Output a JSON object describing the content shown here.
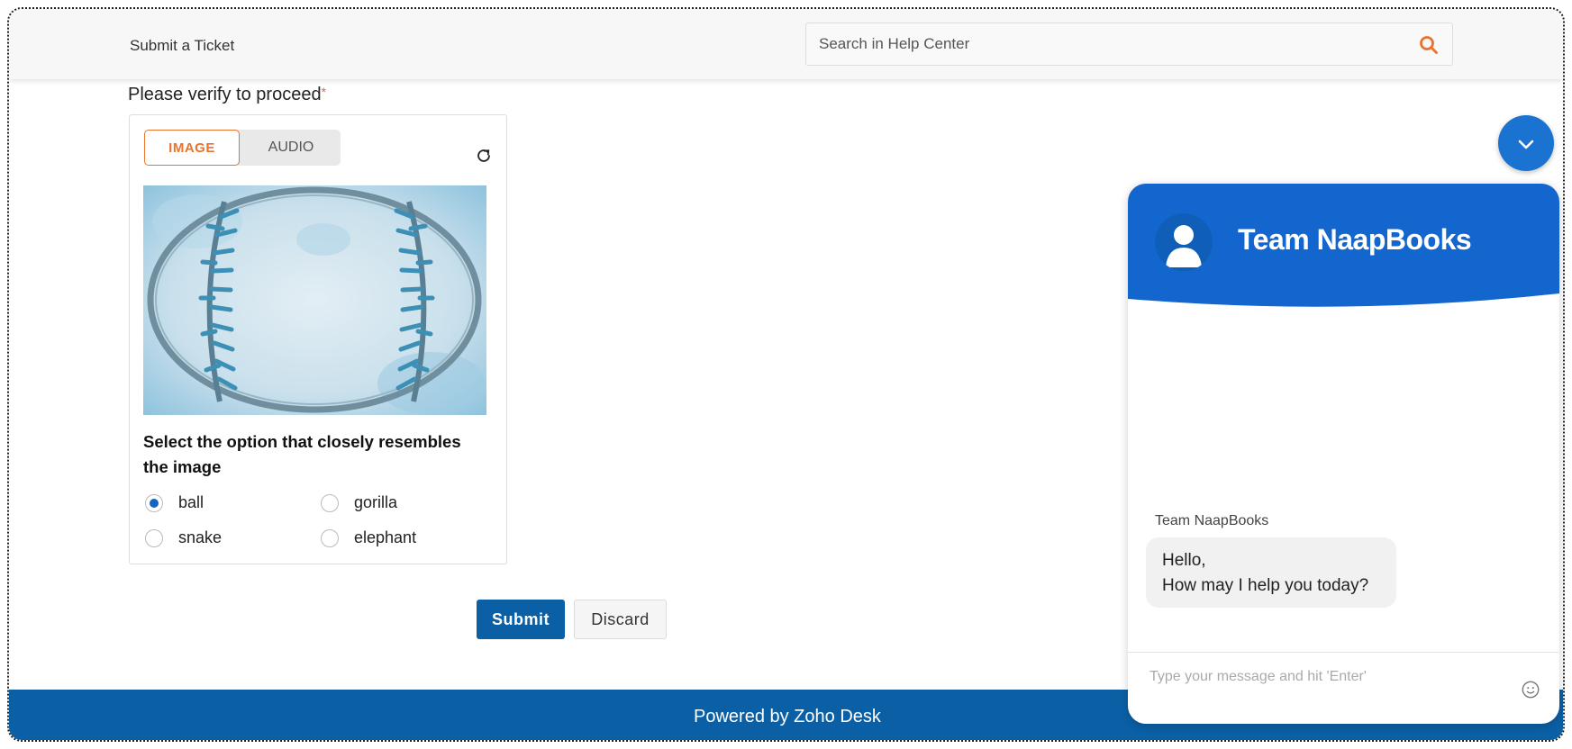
{
  "header": {
    "title": "Submit a Ticket",
    "search_placeholder": "Search in Help Center"
  },
  "verify": {
    "label": "Please verify to proceed",
    "required_mark": "*",
    "tabs": {
      "image": "IMAGE",
      "audio": "AUDIO"
    },
    "active_tab": "IMAGE",
    "question": "Select the option that closely resembles the image",
    "options": [
      "ball",
      "gorilla",
      "snake",
      "elephant"
    ],
    "selected_option": "ball"
  },
  "form": {
    "submit_label": "Submit",
    "discard_label": "Discard"
  },
  "footer": {
    "text": "Powered by Zoho Desk"
  },
  "chat": {
    "title": "Team NaapBooks",
    "agent_name": "Team NaapBooks",
    "message_line1": "Hello,",
    "message_line2": "How may I help you today?",
    "input_placeholder": "Type your message and hit 'Enter'"
  },
  "icons": {
    "search": "search-icon",
    "refresh": "refresh-icon",
    "chevron": "chevron-down-icon",
    "avatar": "user-avatar-icon",
    "emoji": "emoji-icon"
  },
  "colors": {
    "brand_blue": "#0b5fa5",
    "chat_blue": "#1a73d1",
    "accent_orange": "#e8742f",
    "required_red": "#e85d4a"
  }
}
